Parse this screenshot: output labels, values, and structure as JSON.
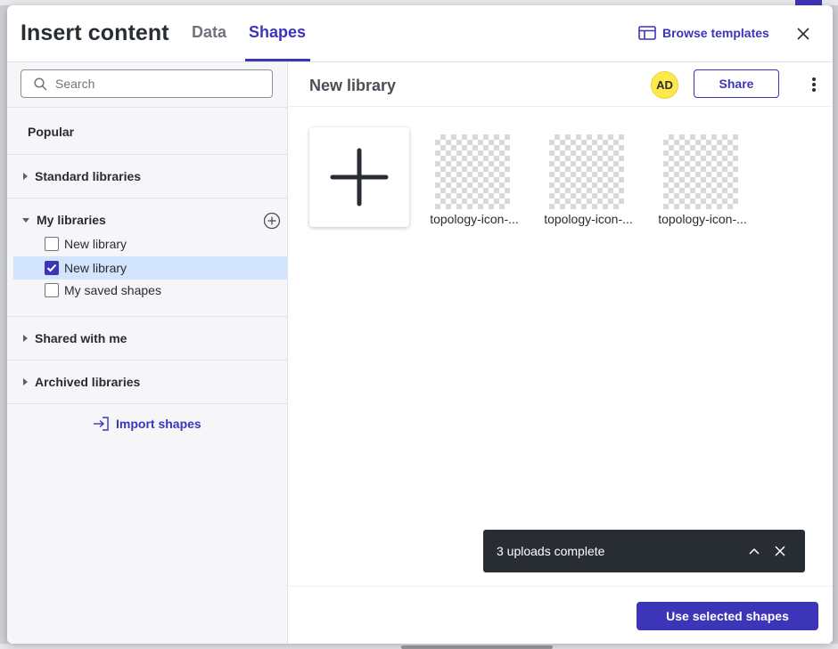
{
  "header": {
    "title": "Insert content",
    "tabs": [
      {
        "label": "Data",
        "active": false
      },
      {
        "label": "Shapes",
        "active": true
      }
    ],
    "browse_templates": "Browse templates"
  },
  "sidebar": {
    "search_placeholder": "Search",
    "popular": "Popular",
    "standard_libraries": "Standard libraries",
    "my_libraries": "My libraries",
    "my_library_items": [
      {
        "label": "New library",
        "checked": false,
        "selected": false
      },
      {
        "label": "New library",
        "checked": true,
        "selected": true
      },
      {
        "label": "My saved shapes",
        "checked": false,
        "selected": false
      }
    ],
    "shared_with_me": "Shared with me",
    "archived_libraries": "Archived libraries",
    "import_shapes": "Import shapes"
  },
  "main": {
    "library_title": "New library",
    "avatar_initials": "AD",
    "share_label": "Share",
    "shapes": [
      {
        "label": "topology-icon-..."
      },
      {
        "label": "topology-icon-..."
      },
      {
        "label": "topology-icon-..."
      }
    ]
  },
  "toast": {
    "message": "3 uploads complete"
  },
  "footer": {
    "use_selected_label": "Use selected shapes"
  },
  "colors": {
    "accent": "#3d35b8",
    "selected_row": "#d3e4fd",
    "avatar": "#fde94a",
    "toast_bg": "#282c33"
  }
}
